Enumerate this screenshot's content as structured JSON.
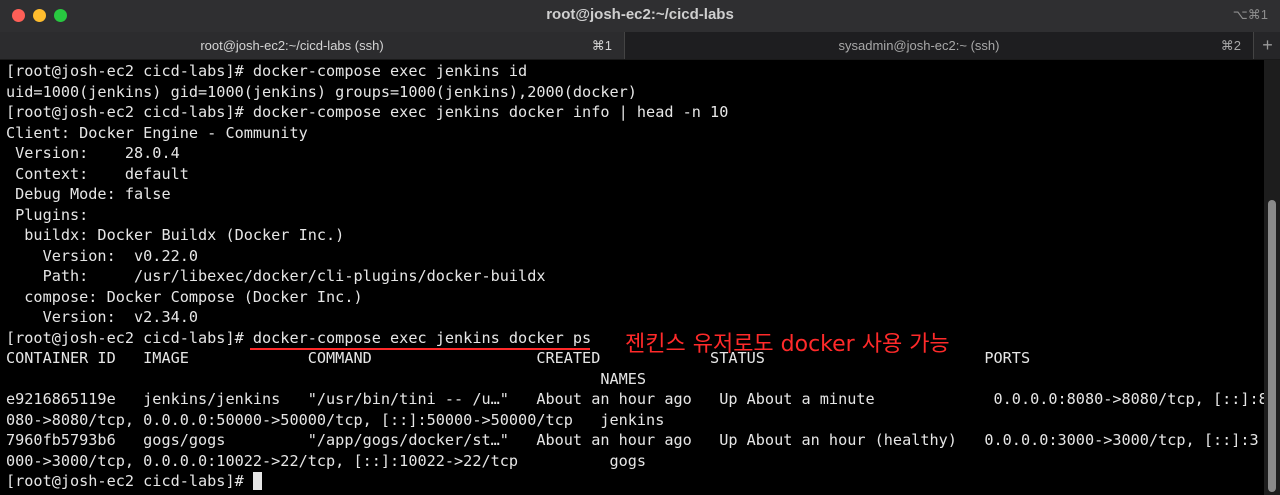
{
  "window": {
    "title": "root@josh-ec2:~/cicd-labs",
    "shortcut": "⌥⌘1"
  },
  "tabs": [
    {
      "label": "root@josh-ec2:~/cicd-labs (ssh)",
      "shortcut": "⌘1"
    },
    {
      "label": "sysadmin@josh-ec2:~ (ssh)",
      "shortcut": "⌘2"
    }
  ],
  "new_tab_label": "+",
  "terminal": {
    "lines": [
      "[root@josh-ec2 cicd-labs]# docker-compose exec jenkins id",
      "uid=1000(jenkins) gid=1000(jenkins) groups=1000(jenkins),2000(docker)",
      "[root@josh-ec2 cicd-labs]# docker-compose exec jenkins docker info | head -n 10",
      "Client: Docker Engine - Community",
      " Version:    28.0.4",
      " Context:    default",
      " Debug Mode: false",
      " Plugins:",
      "  buildx: Docker Buildx (Docker Inc.)",
      "    Version:  v0.22.0",
      "    Path:     /usr/libexec/docker/cli-plugins/docker-buildx",
      "  compose: Docker Compose (Docker Inc.)",
      "    Version:  v2.34.0",
      "[root@josh-ec2 cicd-labs]# docker-compose exec jenkins docker ps",
      "CONTAINER ID   IMAGE             COMMAND                  CREATED            STATUS                        PORTS",
      "                                                                 NAMES",
      "e9216865119e   jenkins/jenkins   \"/usr/bin/tini -- /u…\"   About an hour ago   Up About a minute             0.0.0.0:8080->8080/tcp, [::]:8",
      "080->8080/tcp, 0.0.0.0:50000->50000/tcp, [::]:50000->50000/tcp   jenkins",
      "7960fb5793b6   gogs/gogs         \"/app/gogs/docker/st…\"   About an hour ago   Up About an hour (healthy)   0.0.0.0:3000->3000/tcp, [::]:3",
      "000->3000/tcp, 0.0.0.0:10022->22/tcp, [::]:10022->22/tcp          gogs"
    ],
    "prompt": "[root@josh-ec2 cicd-labs]# "
  },
  "annotation": {
    "text": "젠킨스 유저로도 docker 사용 가능",
    "color": "#ff2a2a"
  },
  "colors": {
    "background": "#000000",
    "text": "#e6e6e6",
    "titlebar": "#2f2f31"
  }
}
